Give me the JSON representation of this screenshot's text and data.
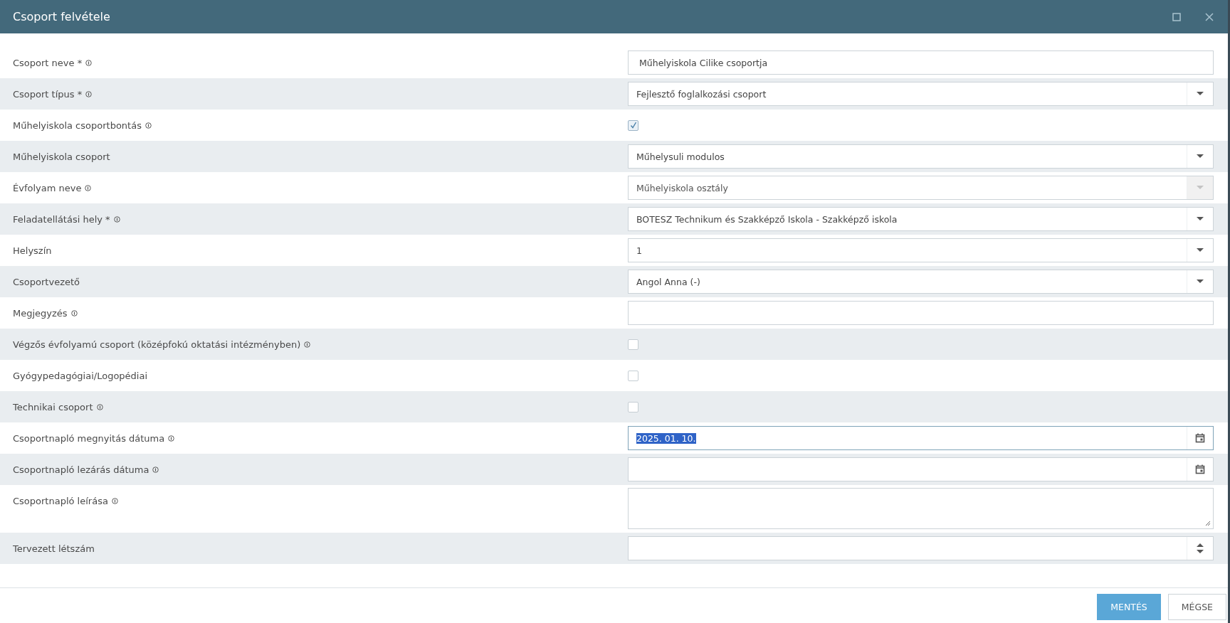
{
  "window": {
    "title": "Csoport felvétele"
  },
  "fields": [
    {
      "label": "Csoport neve *",
      "info": true,
      "kind": "text",
      "value": "Műhelyiskola Cilike csoportja"
    },
    {
      "label": "Csoport típus *",
      "info": true,
      "kind": "select",
      "value": "Fejlesztő foglalkozási csoport",
      "disabled": false
    },
    {
      "label": "Műhelyiskola csoportbontás",
      "info": true,
      "kind": "checkbox",
      "checked": true
    },
    {
      "label": "Műhelyiskola csoport",
      "info": false,
      "kind": "select",
      "value": "Műhelysuli modulos",
      "disabled": false
    },
    {
      "label": "Évfolyam neve",
      "info": true,
      "kind": "select",
      "value": "Műhelyiskola osztály",
      "disabled": true
    },
    {
      "label": "Feladatellátási hely *",
      "info": true,
      "kind": "select",
      "value": "BOTESZ Technikum és Szakképző Iskola - Szakképző iskola",
      "disabled": false
    },
    {
      "label": "Helyszín",
      "info": false,
      "kind": "select",
      "value": "1",
      "disabled": false
    },
    {
      "label": "Csoportvezető",
      "info": false,
      "kind": "select",
      "value": "Angol Anna (-)",
      "disabled": false
    },
    {
      "label": "Megjegyzés",
      "info": true,
      "kind": "text"
    },
    {
      "label": "Végzős évfolyamú csoport (középfokú oktatási intézményben)",
      "info": true,
      "kind": "checkbox",
      "checked": false
    },
    {
      "label": "Gyógypedagógiai/Logopédiai",
      "info": false,
      "kind": "checkbox",
      "checked": false
    },
    {
      "label": "Technikai csoport",
      "info": true,
      "kind": "checkbox",
      "checked": false
    },
    {
      "label": "Csoportnapló megnyitás dátuma",
      "info": true,
      "kind": "date",
      "value": "2025. 01. 10.",
      "focused": true
    },
    {
      "label": "Csoportnapló lezárás dátuma",
      "info": true,
      "kind": "date",
      "focused": false
    },
    {
      "label": "Csoportnapló leírása",
      "info": true,
      "kind": "textarea"
    },
    {
      "label": "Tervezett létszám",
      "info": false,
      "kind": "number"
    }
  ],
  "buttons": [
    {
      "label": "MENTÉS",
      "kind": "primary"
    },
    {
      "label": "MÉGSE",
      "kind": "default"
    }
  ]
}
